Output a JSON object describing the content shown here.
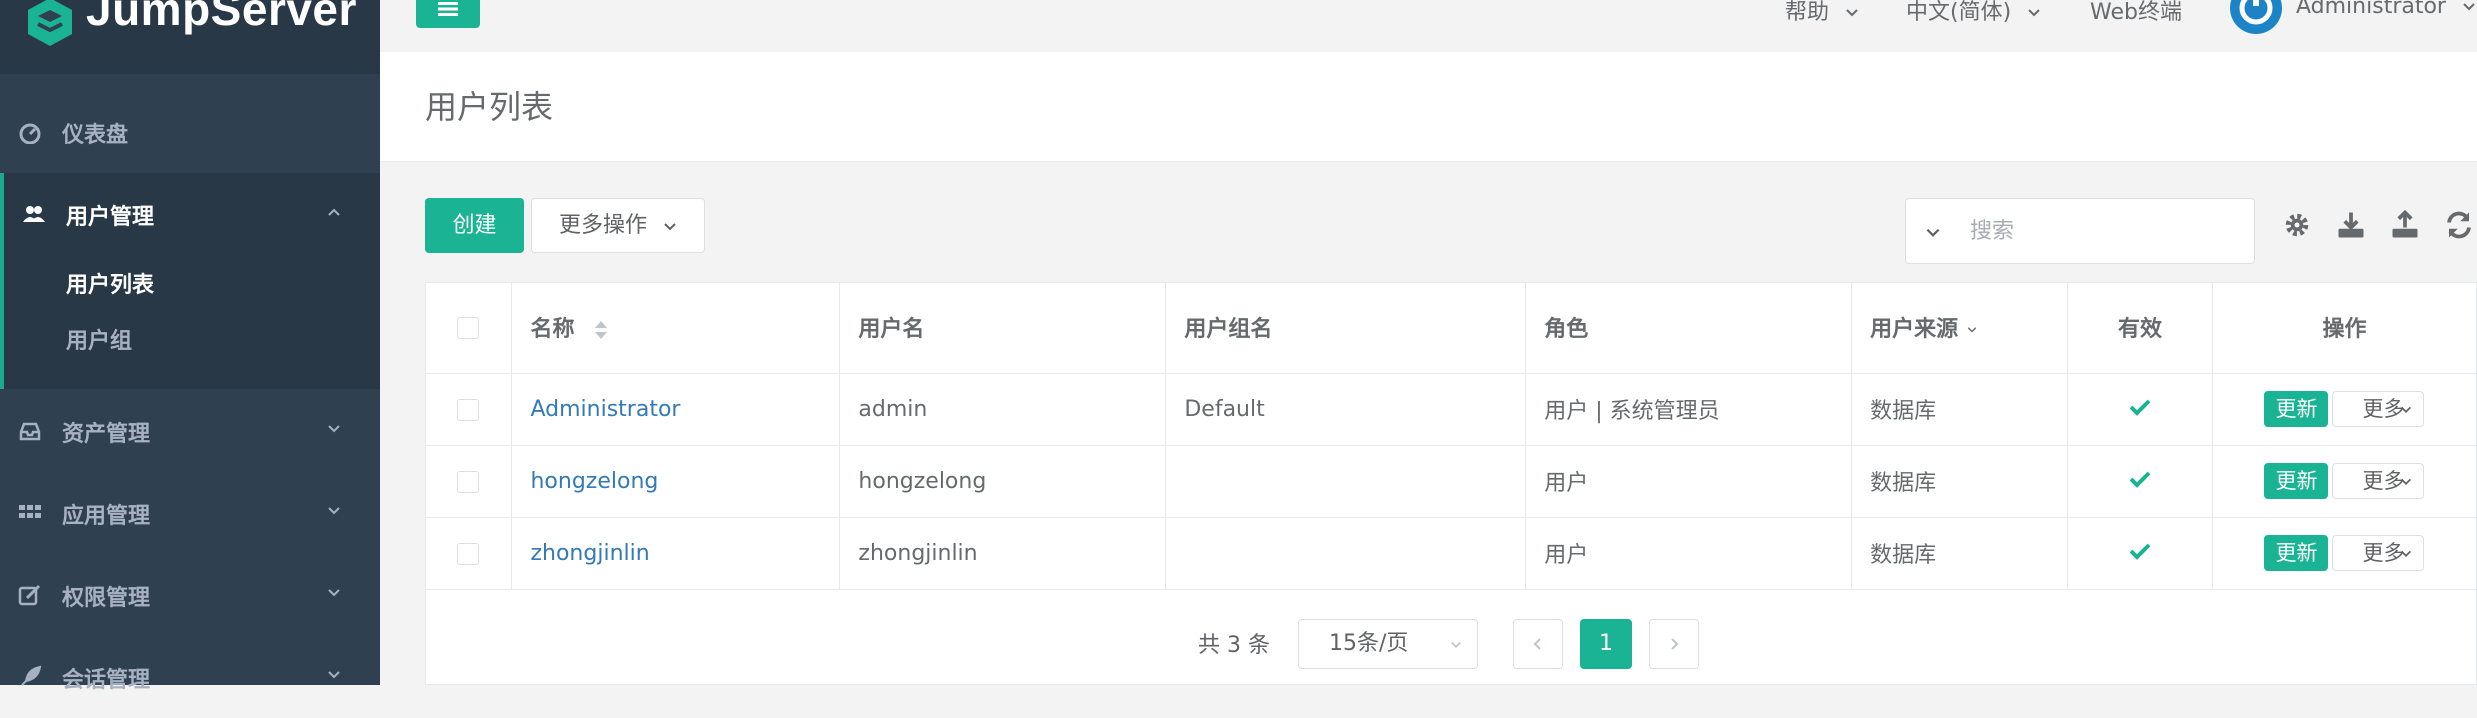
{
  "app": {
    "brand": "JumpServer",
    "accent": "#1ab394",
    "sidebar_bg": "#2f4050"
  },
  "topbar": {
    "help": "帮助",
    "language": "中文(简体)",
    "web_terminal": "Web终端",
    "user": "Administrator"
  },
  "sidebar": {
    "dashboard": "仪表盘",
    "users": "用户管理",
    "users_sub": [
      "用户列表",
      "用户组"
    ],
    "assets": "资产管理",
    "apps": "应用管理",
    "perms": "权限管理",
    "sessions": "会话管理"
  },
  "page": {
    "title": "用户列表"
  },
  "toolbar": {
    "create": "创建",
    "more_actions": "更多操作",
    "search_placeholder": "搜索"
  },
  "table": {
    "headers": {
      "name": "名称",
      "username": "用户名",
      "groups": "用户组名",
      "role": "角色",
      "source": "用户来源",
      "valid": "有效",
      "actions": "操作"
    },
    "rows": [
      {
        "name": "Administrator",
        "username": "admin",
        "groups": "Default",
        "role": "用户 | 系统管理员",
        "source": "数据库",
        "valid": true
      },
      {
        "name": "hongzelong",
        "username": "hongzelong",
        "groups": "",
        "role": "用户",
        "source": "数据库",
        "valid": true
      },
      {
        "name": "zhongjinlin",
        "username": "zhongjinlin",
        "groups": "",
        "role": "用户",
        "source": "数据库",
        "valid": true
      }
    ],
    "update_label": "更新",
    "more_label": "更多"
  },
  "pagination": {
    "total": "共 3 条",
    "page_size": "15条/页",
    "current_page": "1"
  },
  "icons": [
    "dashboard-icon",
    "users-icon",
    "assets-icon",
    "apps-icon",
    "perms-icon",
    "sessions-icon",
    "gear-icon",
    "download-icon",
    "upload-icon",
    "refresh-icon",
    "check-icon",
    "chevron-down-icon"
  ]
}
